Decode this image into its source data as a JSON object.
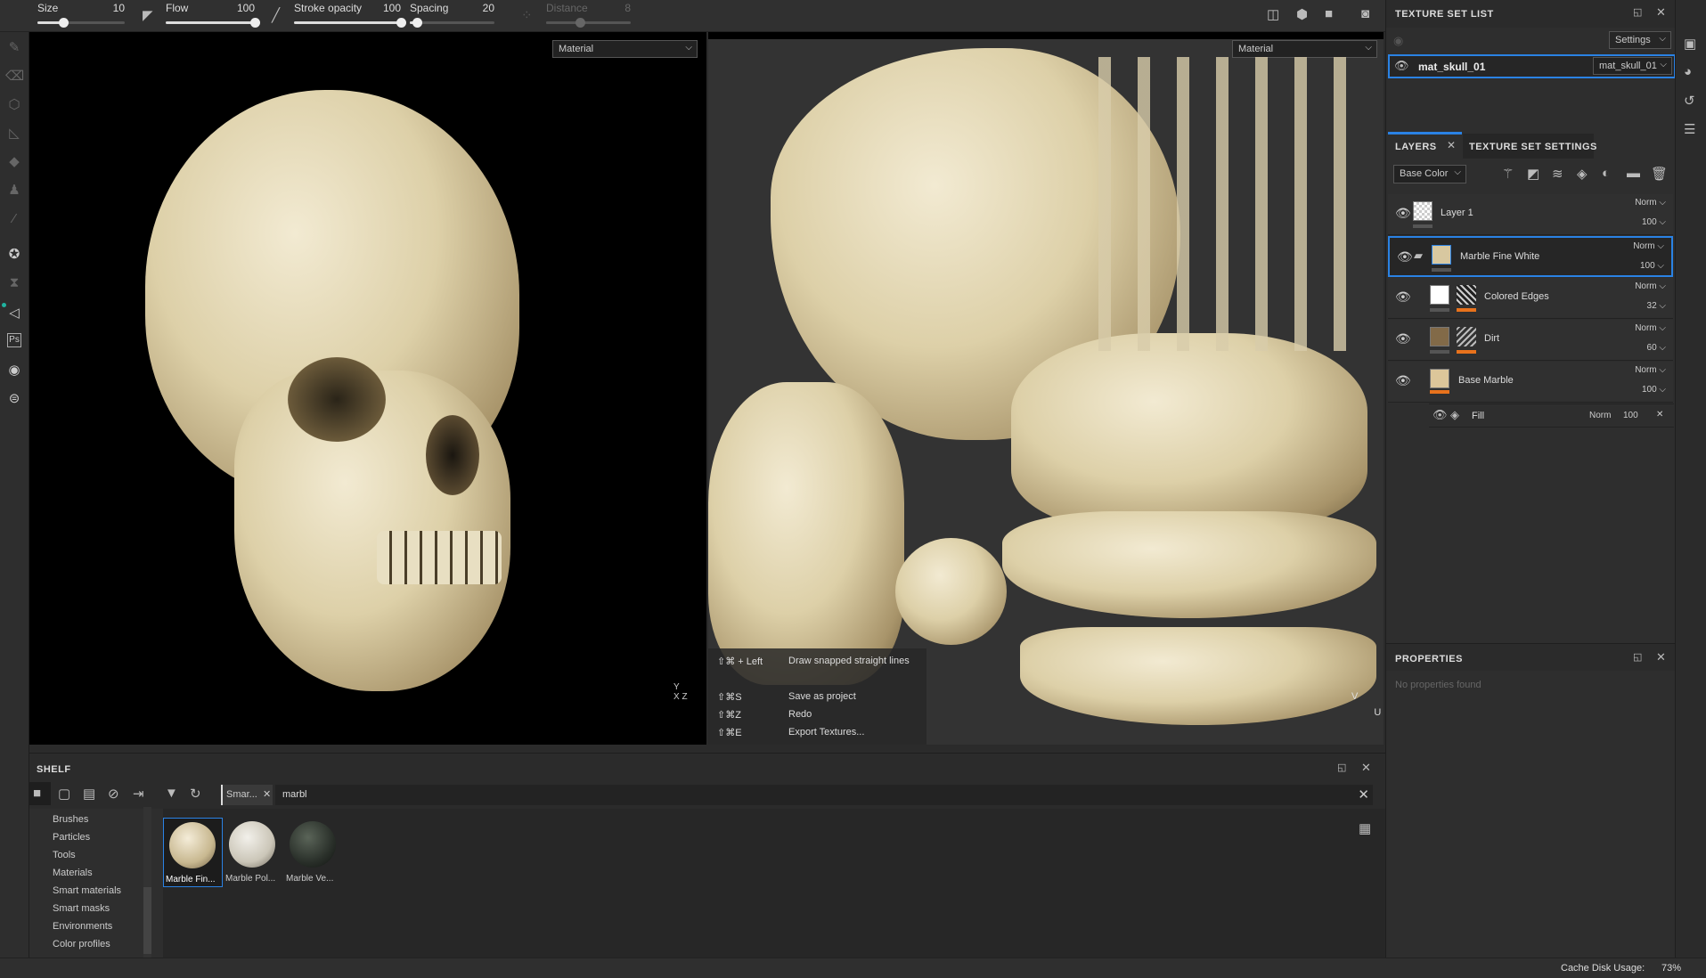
{
  "toolbar": {
    "params": [
      {
        "label": "Size",
        "value": "10",
        "level": 0.35
      },
      {
        "label": "Flow",
        "value": "100",
        "level": 1.0
      },
      {
        "label": "Stroke opacity",
        "value": "100",
        "level": 1.0
      },
      {
        "label": "Spacing",
        "value": "20",
        "level": 0.08
      },
      {
        "label": "Distance",
        "value": "8",
        "level": 0.4,
        "disabled": true
      }
    ]
  },
  "viewport3d": {
    "mode": "Material"
  },
  "viewportuv": {
    "mode": "Material",
    "axis_v": "V",
    "axis_u": "U"
  },
  "axes3d": {
    "y": "Y",
    "x": "X",
    "z": "Z"
  },
  "shortcuts": [
    {
      "keys": "⇧⌘ + Left",
      "action": "Draw snapped straight lines"
    },
    {
      "keys": "⇧⌘S",
      "action": "Save as project"
    },
    {
      "keys": "⇧⌘Z",
      "action": "Redo"
    },
    {
      "keys": "⇧⌘E",
      "action": "Export Textures..."
    }
  ],
  "texture_set_list": {
    "title": "TEXTURE SET LIST",
    "settings": "Settings",
    "item": "mat_skull_01",
    "item_select": "mat_skull_01"
  },
  "layers": {
    "tab": "LAYERS",
    "tab2": "TEXTURE SET SETTINGS",
    "channel": "Base Color",
    "items": [
      {
        "name": "Layer 1",
        "blend": "Norm",
        "opacity": "100"
      },
      {
        "name": "Marble Fine White",
        "blend": "Norm",
        "opacity": "100"
      },
      {
        "name": "Colored Edges",
        "blend": "Norm",
        "opacity": "32"
      },
      {
        "name": "Dirt",
        "blend": "Norm",
        "opacity": "60"
      },
      {
        "name": "Base Marble",
        "blend": "Norm",
        "opacity": "100"
      }
    ],
    "fill": {
      "name": "Fill",
      "blend": "Norm",
      "opacity": "100"
    }
  },
  "properties": {
    "title": "PROPERTIES",
    "empty": "No properties found"
  },
  "shelf": {
    "title": "SHELF",
    "filter_tag": "Smar...",
    "search": "marbl",
    "categories": [
      "Brushes",
      "Particles",
      "Tools",
      "Materials",
      "Smart materials",
      "Smart masks",
      "Environments",
      "Color profiles"
    ],
    "items": [
      {
        "name": "Marble Fin..."
      },
      {
        "name": "Marble Pol..."
      },
      {
        "name": "Marble Ve..."
      }
    ]
  },
  "status": {
    "cache": "Cache Disk Usage:",
    "cache_value": "73%"
  },
  "colors": {
    "accent": "#2a82e4",
    "mask": "#e8721c"
  }
}
